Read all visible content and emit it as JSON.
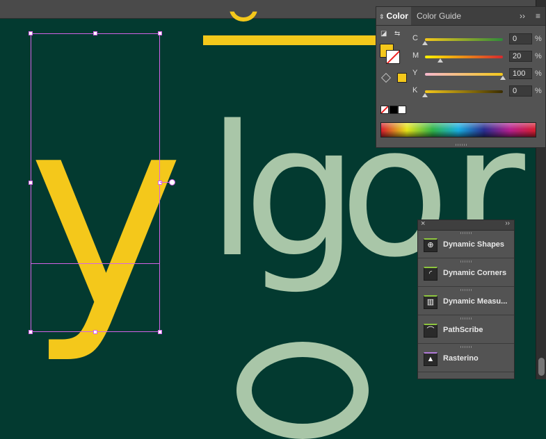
{
  "colors": {
    "yellow": "#f4c81b",
    "sage": "#a9c6a8",
    "background": "#033a30",
    "selection": "#d562e8"
  },
  "canvas": {
    "glyphs": [
      {
        "id": "y",
        "char": "y"
      },
      {
        "id": "l",
        "char": "l"
      },
      {
        "id": "g",
        "char": "g"
      },
      {
        "id": "o",
        "char": "o"
      },
      {
        "id": "r",
        "char": "r"
      }
    ]
  },
  "color_panel": {
    "tab_active": "Color",
    "tab_inactive": "Color Guide",
    "expand_icon": "double-chevron-right-icon",
    "menu_icon": "hamburger-icon",
    "sliders": [
      {
        "label": "C",
        "value": "0",
        "unit": "%",
        "fraction": 0.0
      },
      {
        "label": "M",
        "value": "20",
        "unit": "%",
        "fraction": 0.2
      },
      {
        "label": "Y",
        "value": "100",
        "unit": "%",
        "fraction": 1.0
      },
      {
        "label": "K",
        "value": "0",
        "unit": "%",
        "fraction": 0.0
      }
    ]
  },
  "plugin_panel": {
    "close_icon": "close-icon",
    "expand_icon": "double-chevron-right-icon",
    "items": [
      {
        "label": "Dynamic Shapes",
        "icon": "dynamic-shapes-icon",
        "glyph": "⊕"
      },
      {
        "label": "Dynamic Corners",
        "icon": "dynamic-corners-icon",
        "glyph": "◜"
      },
      {
        "label": "Dynamic Measu...",
        "icon": "dynamic-measure-icon",
        "glyph": "▥"
      },
      {
        "label": "PathScribe",
        "icon": "pathscribe-icon",
        "glyph": "⌒"
      },
      {
        "label": "Rasterino",
        "icon": "rasterino-icon",
        "glyph": "▲"
      }
    ]
  }
}
